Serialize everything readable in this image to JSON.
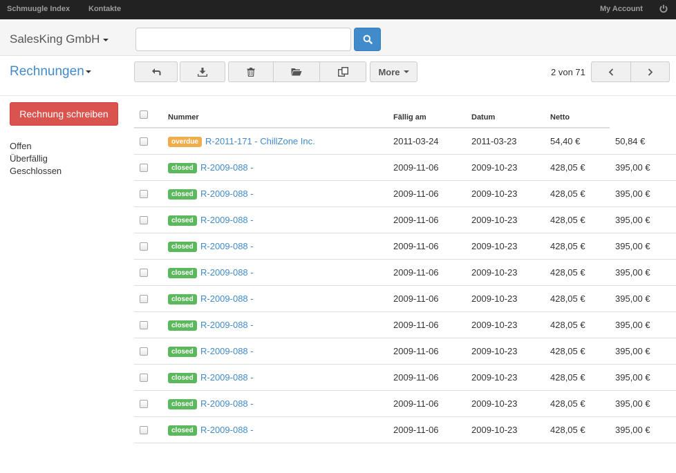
{
  "topbar": {
    "nav": [
      "Schmuugle Index",
      "Kontakte"
    ],
    "account": "My Account",
    "power_icon": "power-icon"
  },
  "header": {
    "company": "SalesKing GmbH",
    "search_value": "",
    "search_icon": "search-icon"
  },
  "toolbar": {
    "title": "Rechnungen",
    "more_label": "More",
    "pager_text": "2 von 71",
    "icons": [
      "reply-icon",
      "download-icon",
      "trash-icon",
      "folder-open-icon",
      "copy-icon",
      "chevron-left-icon",
      "chevron-right-icon"
    ]
  },
  "sidebar": {
    "new_button": "Rechnung schreiben",
    "filters": [
      "Offen",
      "Überfällig",
      "Geschlossen"
    ]
  },
  "table": {
    "columns": [
      "Nummer",
      "Fällig am",
      "Datum",
      "Netto"
    ],
    "rows": [
      {
        "status": "overdue",
        "number": "R-2011-171 - ChillZone Inc.",
        "due": "2011-03-24",
        "date": "2011-03-23",
        "net": "54,40 €",
        "gross": "50,84 €"
      },
      {
        "status": "closed",
        "number": "R-2009-088 -",
        "due": "2009-11-06",
        "date": "2009-10-23",
        "net": "428,05 €",
        "gross": "395,00 €"
      },
      {
        "status": "closed",
        "number": "R-2009-088 -",
        "due": "2009-11-06",
        "date": "2009-10-23",
        "net": "428,05 €",
        "gross": "395,00 €"
      },
      {
        "status": "closed",
        "number": "R-2009-088 -",
        "due": "2009-11-06",
        "date": "2009-10-23",
        "net": "428,05 €",
        "gross": "395,00 €"
      },
      {
        "status": "closed",
        "number": "R-2009-088 -",
        "due": "2009-11-06",
        "date": "2009-10-23",
        "net": "428,05 €",
        "gross": "395,00 €"
      },
      {
        "status": "closed",
        "number": "R-2009-088 -",
        "due": "2009-11-06",
        "date": "2009-10-23",
        "net": "428,05 €",
        "gross": "395,00 €"
      },
      {
        "status": "closed",
        "number": "R-2009-088 -",
        "due": "2009-11-06",
        "date": "2009-10-23",
        "net": "428,05 €",
        "gross": "395,00 €"
      },
      {
        "status": "closed",
        "number": "R-2009-088 -",
        "due": "2009-11-06",
        "date": "2009-10-23",
        "net": "428,05 €",
        "gross": "395,00 €"
      },
      {
        "status": "closed",
        "number": "R-2009-088 -",
        "due": "2009-11-06",
        "date": "2009-10-23",
        "net": "428,05 €",
        "gross": "395,00 €"
      },
      {
        "status": "closed",
        "number": "R-2009-088 -",
        "due": "2009-11-06",
        "date": "2009-10-23",
        "net": "428,05 €",
        "gross": "395,00 €"
      },
      {
        "status": "closed",
        "number": "R-2009-088 -",
        "due": "2009-11-06",
        "date": "2009-10-23",
        "net": "428,05 €",
        "gross": "395,00 €"
      },
      {
        "status": "closed",
        "number": "R-2009-088 -",
        "due": "2009-11-06",
        "date": "2009-10-23",
        "net": "428,05 €",
        "gross": "395,00 €"
      }
    ]
  },
  "colors": {
    "primary": "#428bca",
    "danger": "#d9534f",
    "overdue": "#f0ad4e",
    "closed": "#5cb85c",
    "topbar": "#222222"
  }
}
